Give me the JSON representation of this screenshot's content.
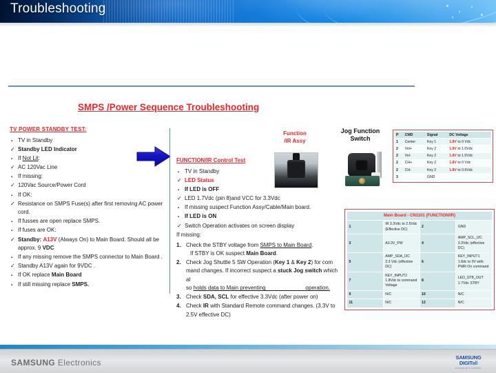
{
  "header": {
    "title": "Troubleshooting"
  },
  "slide": {
    "title": "SMPS /Power Sequence Troubleshooting"
  },
  "left_column": {
    "heading": "TV POWER  STANDBY TEST:",
    "items": [
      {
        "marker": "square",
        "html": "TV in Standby"
      },
      {
        "marker": "check",
        "html": "<span class='b'>Standby LED Indicator</span>"
      },
      {
        "marker": "square",
        "html": "If <span class='u'>Not Lit</span>:"
      },
      {
        "marker": "check",
        "html": "AC 120Vac Line"
      },
      {
        "marker": "square",
        "html": "If missing:"
      },
      {
        "marker": "check",
        "html": "120Vac Source/Power Cord"
      },
      {
        "marker": "square",
        "html": "If OK:"
      },
      {
        "marker": "check",
        "html": "Resistance on SMPS Fuse(s) after first removing AC power cord."
      },
      {
        "marker": "square",
        "html": "If fusses are open replace SMPS."
      },
      {
        "marker": "square",
        "html": "If fuses are OK:"
      },
      {
        "marker": "check",
        "html": "<span class='b'>Standby:</span> <span class='red'>A13V</span> (Always On)  to Main Board. Should all be approx. 9 <span class='b'>VDC</span>"
      },
      {
        "marker": "square",
        "html": "If any missing remove the SMPS connector to Main Board ."
      },
      {
        "marker": "check",
        "html": "Standby A13V again for 9VDC ."
      },
      {
        "marker": "square",
        "html": "If OK replace <span class='b'>Main Board</span>"
      },
      {
        "marker": "square",
        "html": "If still missing replace <span class='b'>SMPS.</span>"
      }
    ]
  },
  "middle_column": {
    "heading": "FUNCTION/IR Control Test",
    "items": [
      {
        "marker": "square",
        "html": "TV in Standby"
      },
      {
        "marker": "check",
        "html": "<span class='red'>LED Status</span>"
      },
      {
        "marker": "square",
        "html": "<span class='b'>If LED is OFF</span>"
      },
      {
        "marker": "check",
        "html": "LED 1.7Vdc (pin  8)and VCC for 3.3Vdc"
      },
      {
        "marker": "square",
        "html": "If missing  suspect Function Assy/Cable/Main  board."
      },
      {
        "marker": "square",
        "html": "<span class='b'>If LED is ON</span>"
      },
      {
        "marker": "check",
        "html": "Switch Operation  activates on screen display"
      }
    ],
    "if_missing": "If missing:",
    "numbered": [
      {
        "num": "1.",
        "html": "Check the STBY voltage from  <span class='u'>SMPS to Main Board</span>.<span class='sub'>If STBY is OK suspect <span class='b'>Main Board</span>.</span>"
      },
      {
        "num": "2.",
        "html": "Check Jog Shuttle 5 SW Operation (<span class='b'>Key 1</span> &amp; <span class='b'>Key 2</span>)      for com<span class='sub nohang'>mand changes. If  incorrect suspect a <span class='b'>stuck Jog  switch</span>  which al</span><span class='sub nohang'>so <span class='u'>holds data to Main preventing&nbsp;&nbsp;&nbsp;&nbsp;&nbsp;&nbsp;&nbsp;&nbsp;&nbsp;&nbsp;&nbsp;&nbsp;&nbsp;&nbsp;&nbsp;&nbsp;&nbsp;&nbsp;&nbsp;&nbsp;&nbsp;&nbsp;&nbsp;&nbsp;&nbsp; operation.</span></span>"
      },
      {
        "num": "3.",
        "html": "Check <span class='b'>SDA, SCL</span> for effective 3.3Vdc (after power on)"
      },
      {
        "num": "4.",
        "html": "Check <span class='b'>IR</span> with Standard Remote  command changes. (3.3V to<span class='sub nohang'>2.5V  effective DC)</span>"
      }
    ]
  },
  "photos": {
    "function_ir_caption_line1": "Function",
    "function_ir_caption_line2": "/IR Assy",
    "jog_caption_line1": "Jog Function",
    "jog_caption_line2": "Switch"
  },
  "jog_table": {
    "headers": [
      "P",
      "CMD",
      "Signal",
      "DC Voltage"
    ],
    "rows": [
      {
        "p": "1",
        "cmd": "Center",
        "signal": "Key 1",
        "v_red": "1.8V",
        "v_rest": " to 0 Vdc"
      },
      {
        "p": "2",
        "cmd": "Vol+",
        "signal": "Key 2",
        "v_red": "1.8V",
        "v_rest": " to 1.0Vdc"
      },
      {
        "p": "2",
        "cmd": "Vol-",
        "signal": "Key 2",
        "v_red": "1.8V",
        "v_rest": " to 1.5Vdc"
      },
      {
        "p": "2",
        "cmd": "CH+",
        "signal": "Key 2",
        "v_red": "1.8V",
        "v_rest": " to 0 Vdc"
      },
      {
        "p": "2",
        "cmd": "CH-",
        "signal": "Key 2",
        "v_red": "1.8V",
        "v_rest": " to 0.6Vdc"
      },
      {
        "p": "3",
        "cmd": "",
        "signal": "GND",
        "v_red": "",
        "v_rest": ""
      }
    ]
  },
  "main_board_table": {
    "title": "Main Board - CN1101 (FUNCTION/IR)",
    "rows": [
      {
        "n1": "1",
        "v1": "IR 3.3Vdc to 2.5Vdc\n(Effective DC)",
        "n2": "2",
        "v2": "GND"
      },
      {
        "n1": "3",
        "v1": "A3.3V_PW",
        "n2": "4",
        "v2": "AMP_SCL_I2C\n   3.3Vdc (effective DC)"
      },
      {
        "n1": "5",
        "v1": "AMP_SDA_I2C\n3.3 Vdc (effective DC)",
        "n2": "6",
        "v2": "KEY_INPUT1\n  1.8dc to 0V with\nPWR On command"
      },
      {
        "n1": "7",
        "v1": "KEY_INPUT2\n1.8Vdc to command\nVoltage",
        "n2": "8",
        "v2": "LED_STB_OUT\n1.7Vdc STBY"
      },
      {
        "n1": "9",
        "v1": "N/C",
        "n2": "10",
        "v2": "N/C"
      },
      {
        "n1": "11",
        "v1": "N/C",
        "n2": "12",
        "v2": "N/C"
      }
    ]
  },
  "footer": {
    "brand_bold": "SAMSUNG",
    "brand_rest": " Electronics",
    "logo_line1_a": "SAMSUNG DIGIT",
    "logo_line1_b": "all",
    "logo_line2": "everyone's invited."
  },
  "colors": {
    "header_blue": "#1279d8",
    "accent_red": "#e8262c",
    "table_border_red": "#c0504d",
    "table_head_teal": "#cfe6e8",
    "rule_blue": "#6f8fb0"
  }
}
